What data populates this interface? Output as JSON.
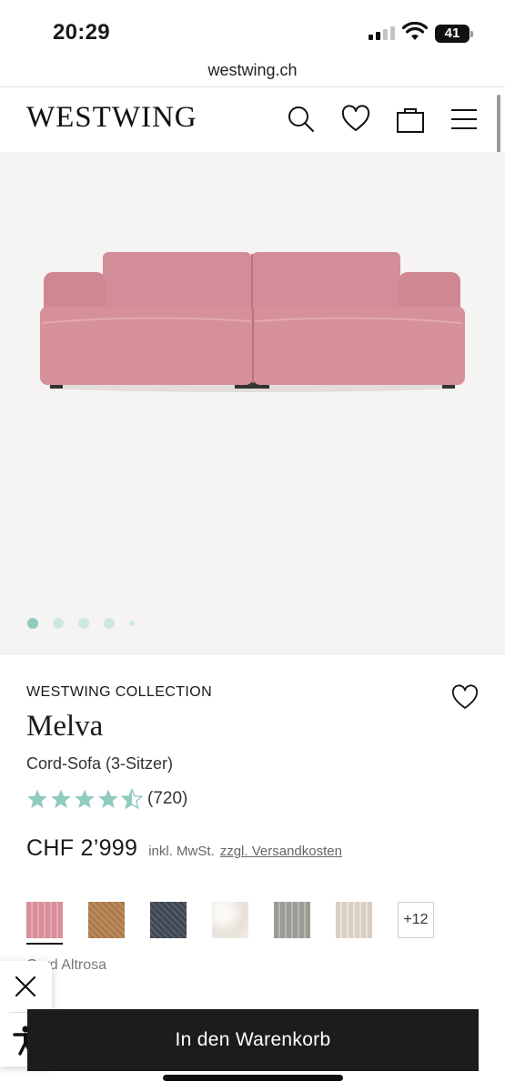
{
  "status_bar": {
    "time": "20:29",
    "battery": "41"
  },
  "browser": {
    "url": "westwing.ch"
  },
  "header": {
    "logo": "WESTWING",
    "icons": [
      "search-icon",
      "heart-icon",
      "shopping-bag-icon",
      "menu-icon"
    ]
  },
  "gallery": {
    "image_count": 5,
    "active_index": 0
  },
  "product": {
    "brand": "WESTWING COLLECTION",
    "name": "Melva",
    "subtitle": "Cord-Sofa (3-Sitzer)",
    "rating": 4.5,
    "reviews": "(720)",
    "price": "CHF 2’999",
    "vat_note": "inkl. MwSt.",
    "shipping_link": "zzgl. Versandkosten"
  },
  "swatches": {
    "colors": [
      "#d88f9a",
      "#b98a5c",
      "#3e4650",
      "#eeeae4",
      "#9b9a94",
      "#d8d0c4"
    ],
    "selected_index": 0,
    "more_label": "+12",
    "selected_label": "Cord Altrosa"
  },
  "cta": {
    "label": "In den Warenkorb"
  },
  "colors": {
    "accent": "#8fcbbe",
    "cta_bg": "#1c1c1c",
    "sofa": "#d6909a"
  }
}
